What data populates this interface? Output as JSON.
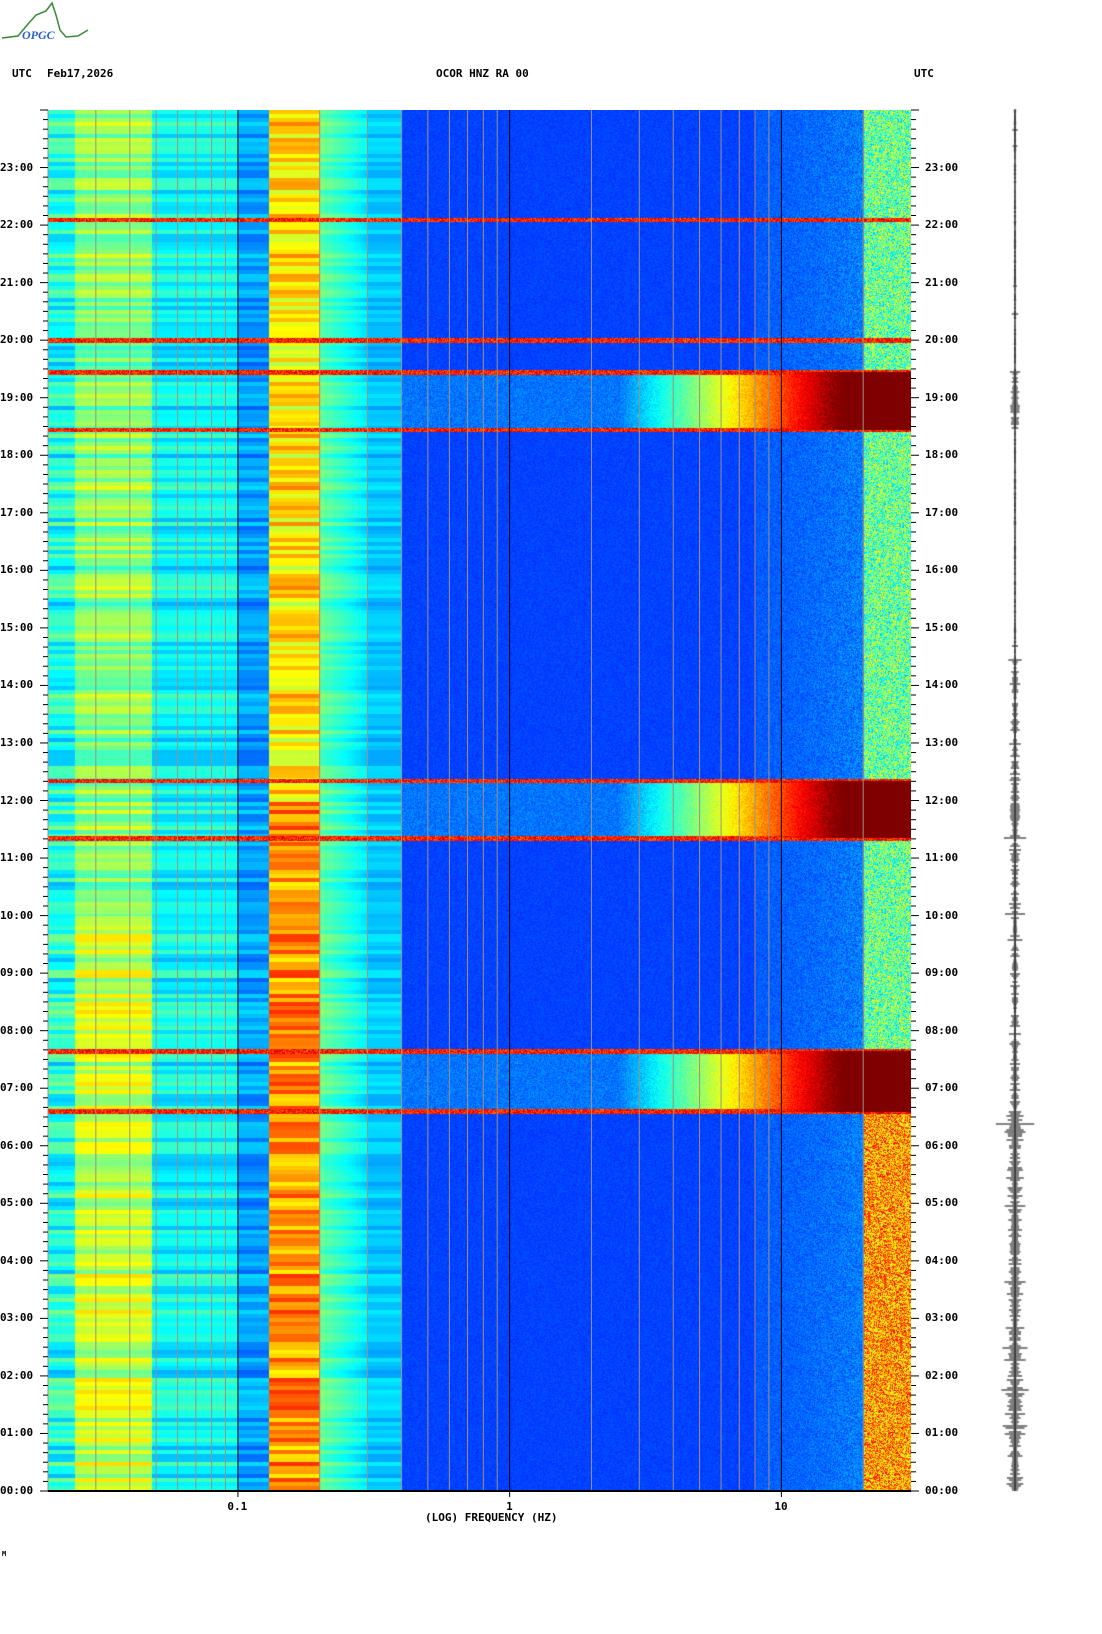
{
  "header": {
    "left_tz": "UTC",
    "date": "Feb17,2026",
    "station": "OCOR HNZ RA 00",
    "right_tz": "UTC",
    "logo_text": "OPGC"
  },
  "footer_mark": "M",
  "colors": {
    "logo_green": "#3a8a3a",
    "logo_blue": "#2a60d0"
  },
  "chart_data": {
    "type": "heatmap",
    "title": "OCOR HNZ RA 00",
    "xlabel": "(LOG) FREQUENCY (HZ)",
    "x_scale": "log",
    "xlim": [
      0.02,
      30
    ],
    "x_ticks": [
      {
        "value": 0.1,
        "label": "0.1"
      },
      {
        "value": 1,
        "label": "1"
      },
      {
        "value": 10,
        "label": "10"
      }
    ],
    "ylabel": "UTC",
    "ylim_hours": [
      0,
      24
    ],
    "y_ticks": [
      "00:00",
      "01:00",
      "02:00",
      "03:00",
      "04:00",
      "05:00",
      "06:00",
      "07:00",
      "08:00",
      "09:00",
      "10:00",
      "11:00",
      "12:00",
      "13:00",
      "14:00",
      "15:00",
      "16:00",
      "17:00",
      "18:00",
      "19:00",
      "20:00",
      "21:00",
      "22:00",
      "23:00"
    ],
    "colormap": "jet",
    "broadband_events_hours": [
      [
        6.6,
        7.65
      ],
      [
        11.35,
        12.35
      ],
      [
        18.45,
        19.45
      ]
    ],
    "narrow_lines_hours": [
      6.6,
      7.65,
      11.35,
      12.35,
      18.45,
      19.45,
      20.0,
      22.1
    ],
    "microseism_peak_hz": [
      0.13,
      0.2
    ],
    "high_freq_noise_band_hz": [
      20,
      30
    ]
  }
}
